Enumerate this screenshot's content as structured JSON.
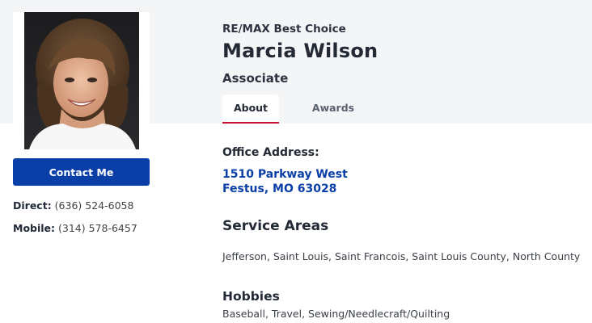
{
  "brokerage": "RE/MAX Best Choice",
  "agent": {
    "name": "Marcia Wilson",
    "title": "Associate"
  },
  "tabs": [
    {
      "label": "About",
      "active": true
    },
    {
      "label": "Awards",
      "active": false
    }
  ],
  "contact": {
    "button_label": "Contact Me",
    "direct_label": "Direct:",
    "direct_number": "(636) 524-6058",
    "mobile_label": "Mobile:",
    "mobile_number": "(314) 578-6457"
  },
  "office": {
    "label": "Office Address:",
    "line1": "1510 Parkway West",
    "line2": "Festus, MO 63028"
  },
  "service_areas": {
    "heading": "Service Areas",
    "text": "Jefferson, Saint Louis, Saint Francois, Saint Louis County, North County"
  },
  "hobbies": {
    "heading": "Hobbies",
    "text": "Baseball, Travel, Sewing/Needlecraft/Quilting"
  },
  "colors": {
    "accent_blue": "#0a3fa8",
    "tab_underline_red": "#c8102e",
    "header_band": "#f4f5f7"
  }
}
